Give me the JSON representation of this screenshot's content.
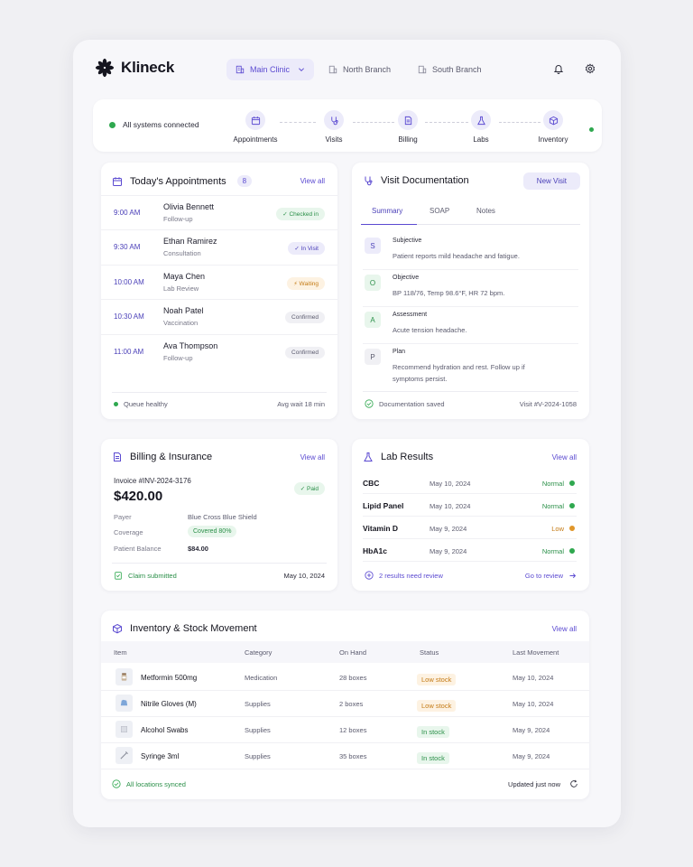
{
  "app": {
    "name": "Klineck"
  },
  "branches": [
    {
      "label": "Main Clinic",
      "active": true
    },
    {
      "label": "North Branch",
      "active": false
    },
    {
      "label": "South Branch",
      "active": false
    }
  ],
  "status": {
    "text": "All systems connected",
    "steps": [
      "Appointments",
      "Visits",
      "Billing",
      "Labs",
      "Inventory"
    ]
  },
  "appointments": {
    "title": "Today's Appointments",
    "count": "8",
    "view_all": "View all",
    "rows": [
      {
        "time": "9:00 AM",
        "name": "Olivia Bennett",
        "type": "Follow-up",
        "status": "✓ Checked in",
        "tone": "green"
      },
      {
        "time": "9:30 AM",
        "name": "Ethan Ramirez",
        "type": "Consultation",
        "status": "✓ In Visit",
        "tone": "blue"
      },
      {
        "time": "10:00 AM",
        "name": "Maya Chen",
        "type": "Lab Review",
        "status": "⚡ Waiting",
        "tone": "orange"
      },
      {
        "time": "10:30 AM",
        "name": "Noah Patel",
        "type": "Vaccination",
        "status": "Confirmed",
        "tone": "gray"
      },
      {
        "time": "11:00 AM",
        "name": "Ava Thompson",
        "type": "Follow-up",
        "status": "Confirmed",
        "tone": "gray"
      }
    ],
    "footer_left": "Queue healthy",
    "footer_right": "Avg wait 18 min"
  },
  "visit": {
    "title": "Visit Documentation",
    "new_visit": "New Visit",
    "tabs": [
      "Summary",
      "SOAP",
      "Notes"
    ],
    "soap": [
      {
        "letter": "S",
        "title": "Subjective",
        "text": "Patient reports mild headache and fatigue."
      },
      {
        "letter": "O",
        "title": "Objective",
        "text": "BP 118/76, Temp 98.6°F, HR 72 bpm."
      },
      {
        "letter": "A",
        "title": "Assessment",
        "text": "Acute tension headache."
      },
      {
        "letter": "P",
        "title": "Plan",
        "text": "Recommend hydration and rest. Follow up if symptoms persist."
      }
    ],
    "footer_left": "Documentation saved",
    "footer_right": "Visit #V-2024-1058"
  },
  "billing": {
    "title": "Billing & Insurance",
    "view_all": "View all",
    "invoice": "Invoice #INV-2024-3176",
    "amount": "$420.00",
    "paid": "✓ Paid",
    "payer_label": "Payer",
    "payer": "Blue Cross Blue Shield",
    "coverage_label": "Coverage",
    "coverage": "Covered 80%",
    "balance_label": "Patient Balance",
    "balance": "$84.00",
    "footer_left": "Claim submitted",
    "footer_right": "May 10, 2024"
  },
  "labs": {
    "title": "Lab Results",
    "view_all": "View all",
    "rows": [
      {
        "name": "CBC",
        "date": "May 10, 2024",
        "status": "Normal",
        "color": "#2fa84f"
      },
      {
        "name": "Lipid Panel",
        "date": "May 10, 2024",
        "status": "Normal",
        "color": "#2fa84f"
      },
      {
        "name": "Vitamin D",
        "date": "May 9, 2024",
        "status": "Low",
        "color": "#e0962a"
      },
      {
        "name": "HbA1c",
        "date": "May 9, 2024",
        "status": "Normal",
        "color": "#2fa84f"
      }
    ],
    "footer_left": "2 results need review",
    "footer_right": "Go to review"
  },
  "inventory": {
    "title": "Inventory & Stock Movement",
    "view_all": "View all",
    "columns": [
      "Item",
      "Category",
      "On Hand",
      "Status",
      "Last Movement"
    ],
    "rows": [
      {
        "item": "Metformin 500mg",
        "category": "Medication",
        "on_hand": "28 boxes",
        "status": "Low stock",
        "tone": "low",
        "last": "May 10, 2024"
      },
      {
        "item": "Nitrile Gloves (M)",
        "category": "Supplies",
        "on_hand": "2 boxes",
        "status": "Low stock",
        "tone": "low",
        "last": "May 10, 2024"
      },
      {
        "item": "Alcohol Swabs",
        "category": "Supplies",
        "on_hand": "12 boxes",
        "status": "In stock",
        "tone": "in",
        "last": "May 9, 2024"
      },
      {
        "item": "Syringe 3ml",
        "category": "Supplies",
        "on_hand": "35 boxes",
        "status": "In stock",
        "tone": "in",
        "last": "May 9, 2024"
      }
    ],
    "footer_left": "All locations synced",
    "footer_right": "Updated just now"
  },
  "colors": {
    "accent": "#5b4ad1",
    "success": "#2fa84f",
    "warning": "#e0962a"
  },
  "icons": [
    "logo-asterisk-icon",
    "building-icon",
    "chevron-down-icon",
    "bell-icon",
    "gear-icon",
    "calendar-icon",
    "stethoscope-icon",
    "document-icon",
    "flask-icon",
    "box-icon",
    "check-circle-icon",
    "refresh-icon",
    "arrow-right-icon"
  ]
}
